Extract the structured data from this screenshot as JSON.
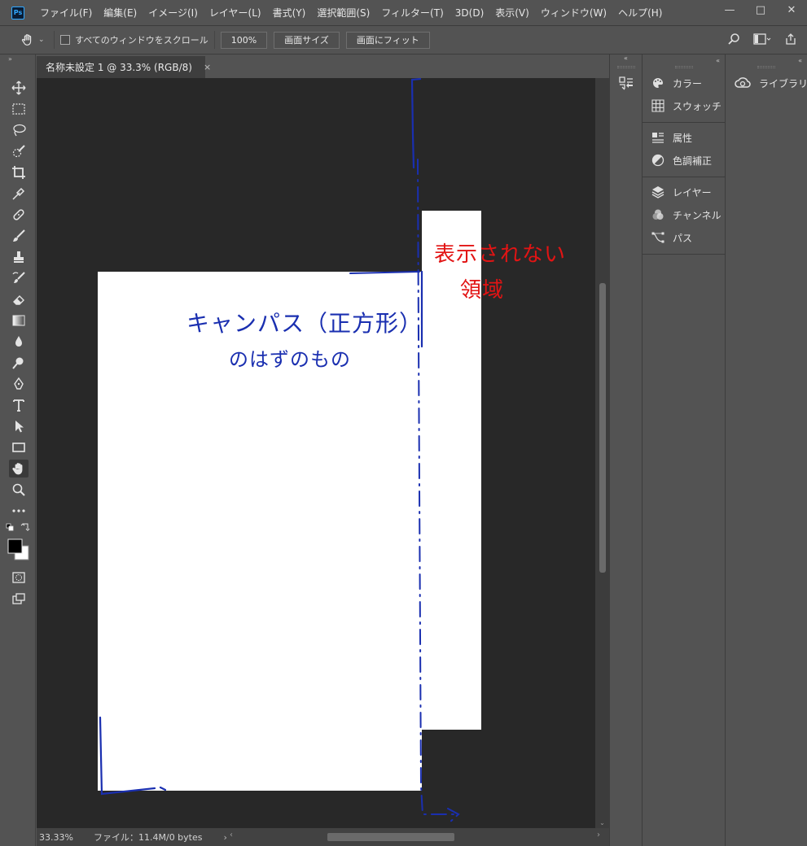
{
  "app": {
    "logo": "Ps"
  },
  "menu": [
    "ファイル(F)",
    "編集(E)",
    "イメージ(I)",
    "レイヤー(L)",
    "書式(Y)",
    "選択範囲(S)",
    "フィルター(T)",
    "3D(D)",
    "表示(V)",
    "ウィンドウ(W)",
    "ヘルプ(H)"
  ],
  "window_controls": {
    "minimize": "—",
    "maximize": "□",
    "close": "✕"
  },
  "options": {
    "scroll_all_label": "すべてのウィンドウをスクロール",
    "zoom_100": "100%",
    "fit_screen": "画面サイズ",
    "fill_screen": "画面にフィット"
  },
  "document": {
    "tab_title": "名称未設定 1 @ 33.3% (RGB/8)",
    "close": "×"
  },
  "annotations": {
    "canvas_note_line1": "キャンパス（正方形）",
    "canvas_note_line2": "のはずのもの",
    "hidden_note_line1": "表示されない",
    "hidden_note_line2": "領域"
  },
  "status": {
    "zoom": "33.33%",
    "file_info": "ファイル：11.4M/0 bytes",
    "arrow": "›"
  },
  "panels": {
    "group1": [
      {
        "label": "カラー",
        "icon": "palette-icon"
      },
      {
        "label": "スウォッチ",
        "icon": "swatches-grid-icon"
      }
    ],
    "group2": [
      {
        "label": "属性",
        "icon": "properties-icon"
      },
      {
        "label": "色調補正",
        "icon": "adjustments-icon"
      }
    ],
    "group3": [
      {
        "label": "レイヤー",
        "icon": "layers-icon"
      },
      {
        "label": "チャンネル",
        "icon": "channels-icon"
      },
      {
        "label": "パス",
        "icon": "paths-icon"
      }
    ],
    "library": {
      "label": "ライブラリ",
      "icon": "cc-libraries-icon"
    }
  },
  "colors": {
    "annotation_blue": "#1a2fb0",
    "annotation_red": "#e21414",
    "canvas_bg": "#282828",
    "ui_bg": "#535353"
  }
}
